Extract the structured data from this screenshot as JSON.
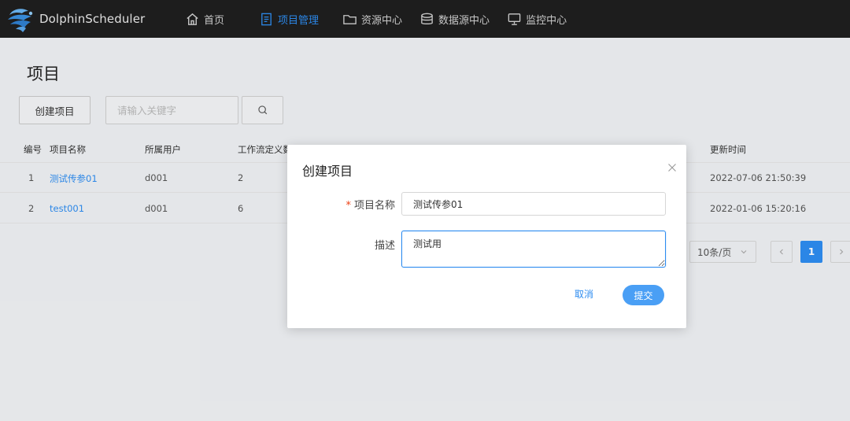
{
  "header": {
    "brand": "DolphinScheduler",
    "nav": [
      {
        "label": "首页",
        "icon": "home-icon"
      },
      {
        "label": "项目管理",
        "icon": "document-icon",
        "active": true
      },
      {
        "label": "资源中心",
        "icon": "folder-icon"
      },
      {
        "label": "数据源中心",
        "icon": "database-icon"
      },
      {
        "label": "监控中心",
        "icon": "monitor-icon"
      }
    ],
    "active_color": "#2d8cf0"
  },
  "page": {
    "title": "项目",
    "create_label": "创建项目",
    "search_placeholder": "请输入关键字"
  },
  "table": {
    "columns": [
      "编号",
      "项目名称",
      "所属用户",
      "工作流定义数",
      "更新时间"
    ],
    "rows": [
      {
        "no": "1",
        "name": "测试传参01",
        "owner": "d001",
        "workflows": "2",
        "updated": "2022-07-06 21:50:39"
      },
      {
        "no": "2",
        "name": "test001",
        "owner": "d001",
        "workflows": "6",
        "updated": "2022-01-06 15:20:16"
      }
    ]
  },
  "pagination": {
    "page_size": "10条/页",
    "current_page": "1"
  },
  "modal": {
    "title": "创建项目",
    "required_mark": "*",
    "name_label": "项目名称",
    "name_value": "测试传参01",
    "desc_label": "描述",
    "desc_value": "测试用",
    "cancel_label": "取消",
    "submit_label": "提交",
    "primary_color": "#2d8cf0"
  }
}
